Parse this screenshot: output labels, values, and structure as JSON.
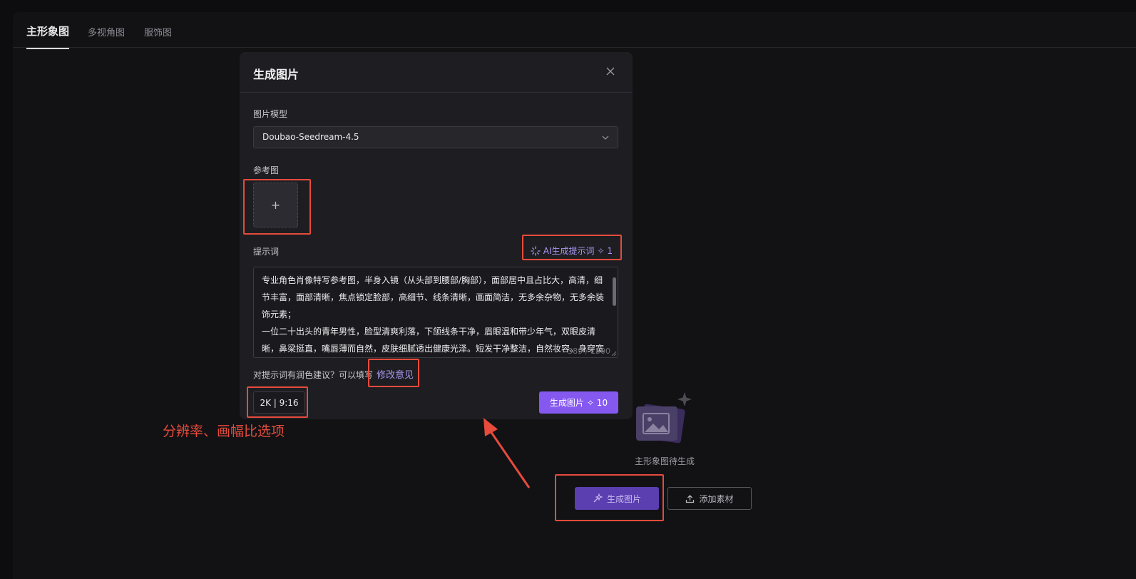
{
  "tabs": [
    {
      "label": "主形象图",
      "active": true
    },
    {
      "label": "多视角图",
      "active": false
    },
    {
      "label": "服饰图",
      "active": false
    }
  ],
  "empty_state": {
    "text": "主形象图待生成",
    "generate_label": "生成图片",
    "add_material_label": "添加素材"
  },
  "modal": {
    "title": "生成图片",
    "model_label": "图片模型",
    "model_value": "Doubao-Seedream-4.5",
    "reference_label": "参考图",
    "upload_symbol": "+",
    "prompt_label": "提示词",
    "ai_prompt_label": "AI生成提示词",
    "ai_prompt_cost": "✧ 1",
    "prompt_text": "专业角色肖像特写参考图，半身入镜（从头部到腰部/胸部），面部居中且占比大，高清，细节丰富，面部清晰，焦点锁定脸部，高细节、线条清晰，画面简洁，无多余杂物，无多余装饰元素；\n一位二十出头的青年男性，脸型清爽利落，下颌线条干净，眉眼温和带少年气，双眼皮清晰，鼻梁挺直，嘴唇薄而自然，皮肤细腻透出健康光泽。短发干净整洁，自然妆容。身穿宽",
    "char_count": "389 / 1500",
    "suggest_text": "对提示词有润色建议？可以填写",
    "suggest_link": "修改意见",
    "resolution_ratio": "2K | 9:16",
    "generate_label": "生成图片",
    "generate_cost": "✧ 10"
  },
  "annotation": {
    "text": "分辨率、画幅比选项",
    "color": "#e64b3c"
  },
  "colors": {
    "accent": "#8559f0",
    "accent_text": "#a996ef",
    "annotation_red": "#e64b3c"
  }
}
